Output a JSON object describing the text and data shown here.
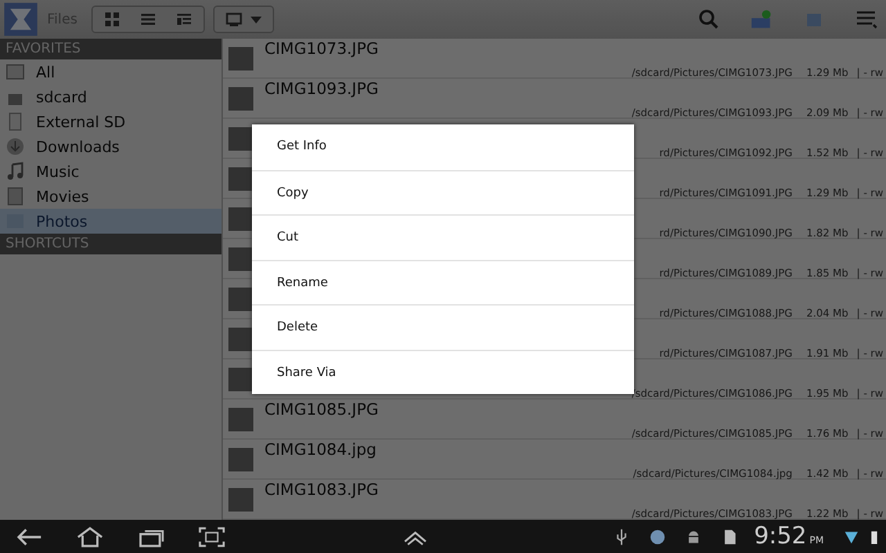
{
  "toolbar": {
    "title": "Files"
  },
  "sidebar": {
    "sections": [
      {
        "title": "FAVORITES",
        "items": [
          {
            "label": "All",
            "kind": "drive",
            "selected": false
          },
          {
            "label": "sdcard",
            "kind": "card",
            "selected": false
          },
          {
            "label": "External SD",
            "kind": "usb",
            "selected": false
          },
          {
            "label": "Downloads",
            "kind": "download",
            "selected": false
          },
          {
            "label": "Music",
            "kind": "music",
            "selected": false
          },
          {
            "label": "Movies",
            "kind": "film",
            "selected": false
          },
          {
            "label": "Photos",
            "kind": "photo",
            "selected": true
          }
        ]
      },
      {
        "title": "SHORTCUTS"
      }
    ]
  },
  "files": [
    {
      "name": "CIMG1073.JPG",
      "path": "/sdcard/Pictures/CIMG1073.JPG",
      "size": "1.29 Mb",
      "perm": "| - rw"
    },
    {
      "name": "CIMG1093.JPG",
      "path": "/sdcard/Pictures/CIMG1093.JPG",
      "size": "2.09 Mb",
      "perm": "| - rw"
    },
    {
      "path": "rd/Pictures/CIMG1092.JPG",
      "size": "1.52 Mb",
      "perm": "| - rw"
    },
    {
      "path": "rd/Pictures/CIMG1091.JPG",
      "size": "1.29 Mb",
      "perm": "| - rw"
    },
    {
      "path": "rd/Pictures/CIMG1090.JPG",
      "size": "1.82 Mb",
      "perm": "| - rw"
    },
    {
      "path": "rd/Pictures/CIMG1089.JPG",
      "size": "1.85 Mb",
      "perm": "| - rw"
    },
    {
      "path": "rd/Pictures/CIMG1088.JPG",
      "size": "2.04 Mb",
      "perm": "| - rw"
    },
    {
      "path": "rd/Pictures/CIMG1087.JPG",
      "size": "1.91 Mb",
      "perm": "| - rw"
    },
    {
      "path": "/sdcard/Pictures/CIMG1086.JPG",
      "size": "1.95 Mb",
      "perm": "| - rw"
    },
    {
      "name": "CIMG1085.JPG",
      "path": "/sdcard/Pictures/CIMG1085.JPG",
      "size": "1.76 Mb",
      "perm": "| - rw"
    },
    {
      "name": "CIMG1084.jpg",
      "path": "/sdcard/Pictures/CIMG1084.jpg",
      "size": "1.42 Mb",
      "perm": "| - rw"
    },
    {
      "name": "CIMG1083.JPG",
      "path": "/sdcard/Pictures/CIMG1083.JPG",
      "size": "1.22 Mb",
      "perm": "| - rw"
    }
  ],
  "context_menu": [
    "Get Info",
    "Copy",
    "Cut",
    "Rename",
    "Delete",
    "Share Via"
  ],
  "navbar": {
    "time": "9:52",
    "ampm": "PM"
  }
}
